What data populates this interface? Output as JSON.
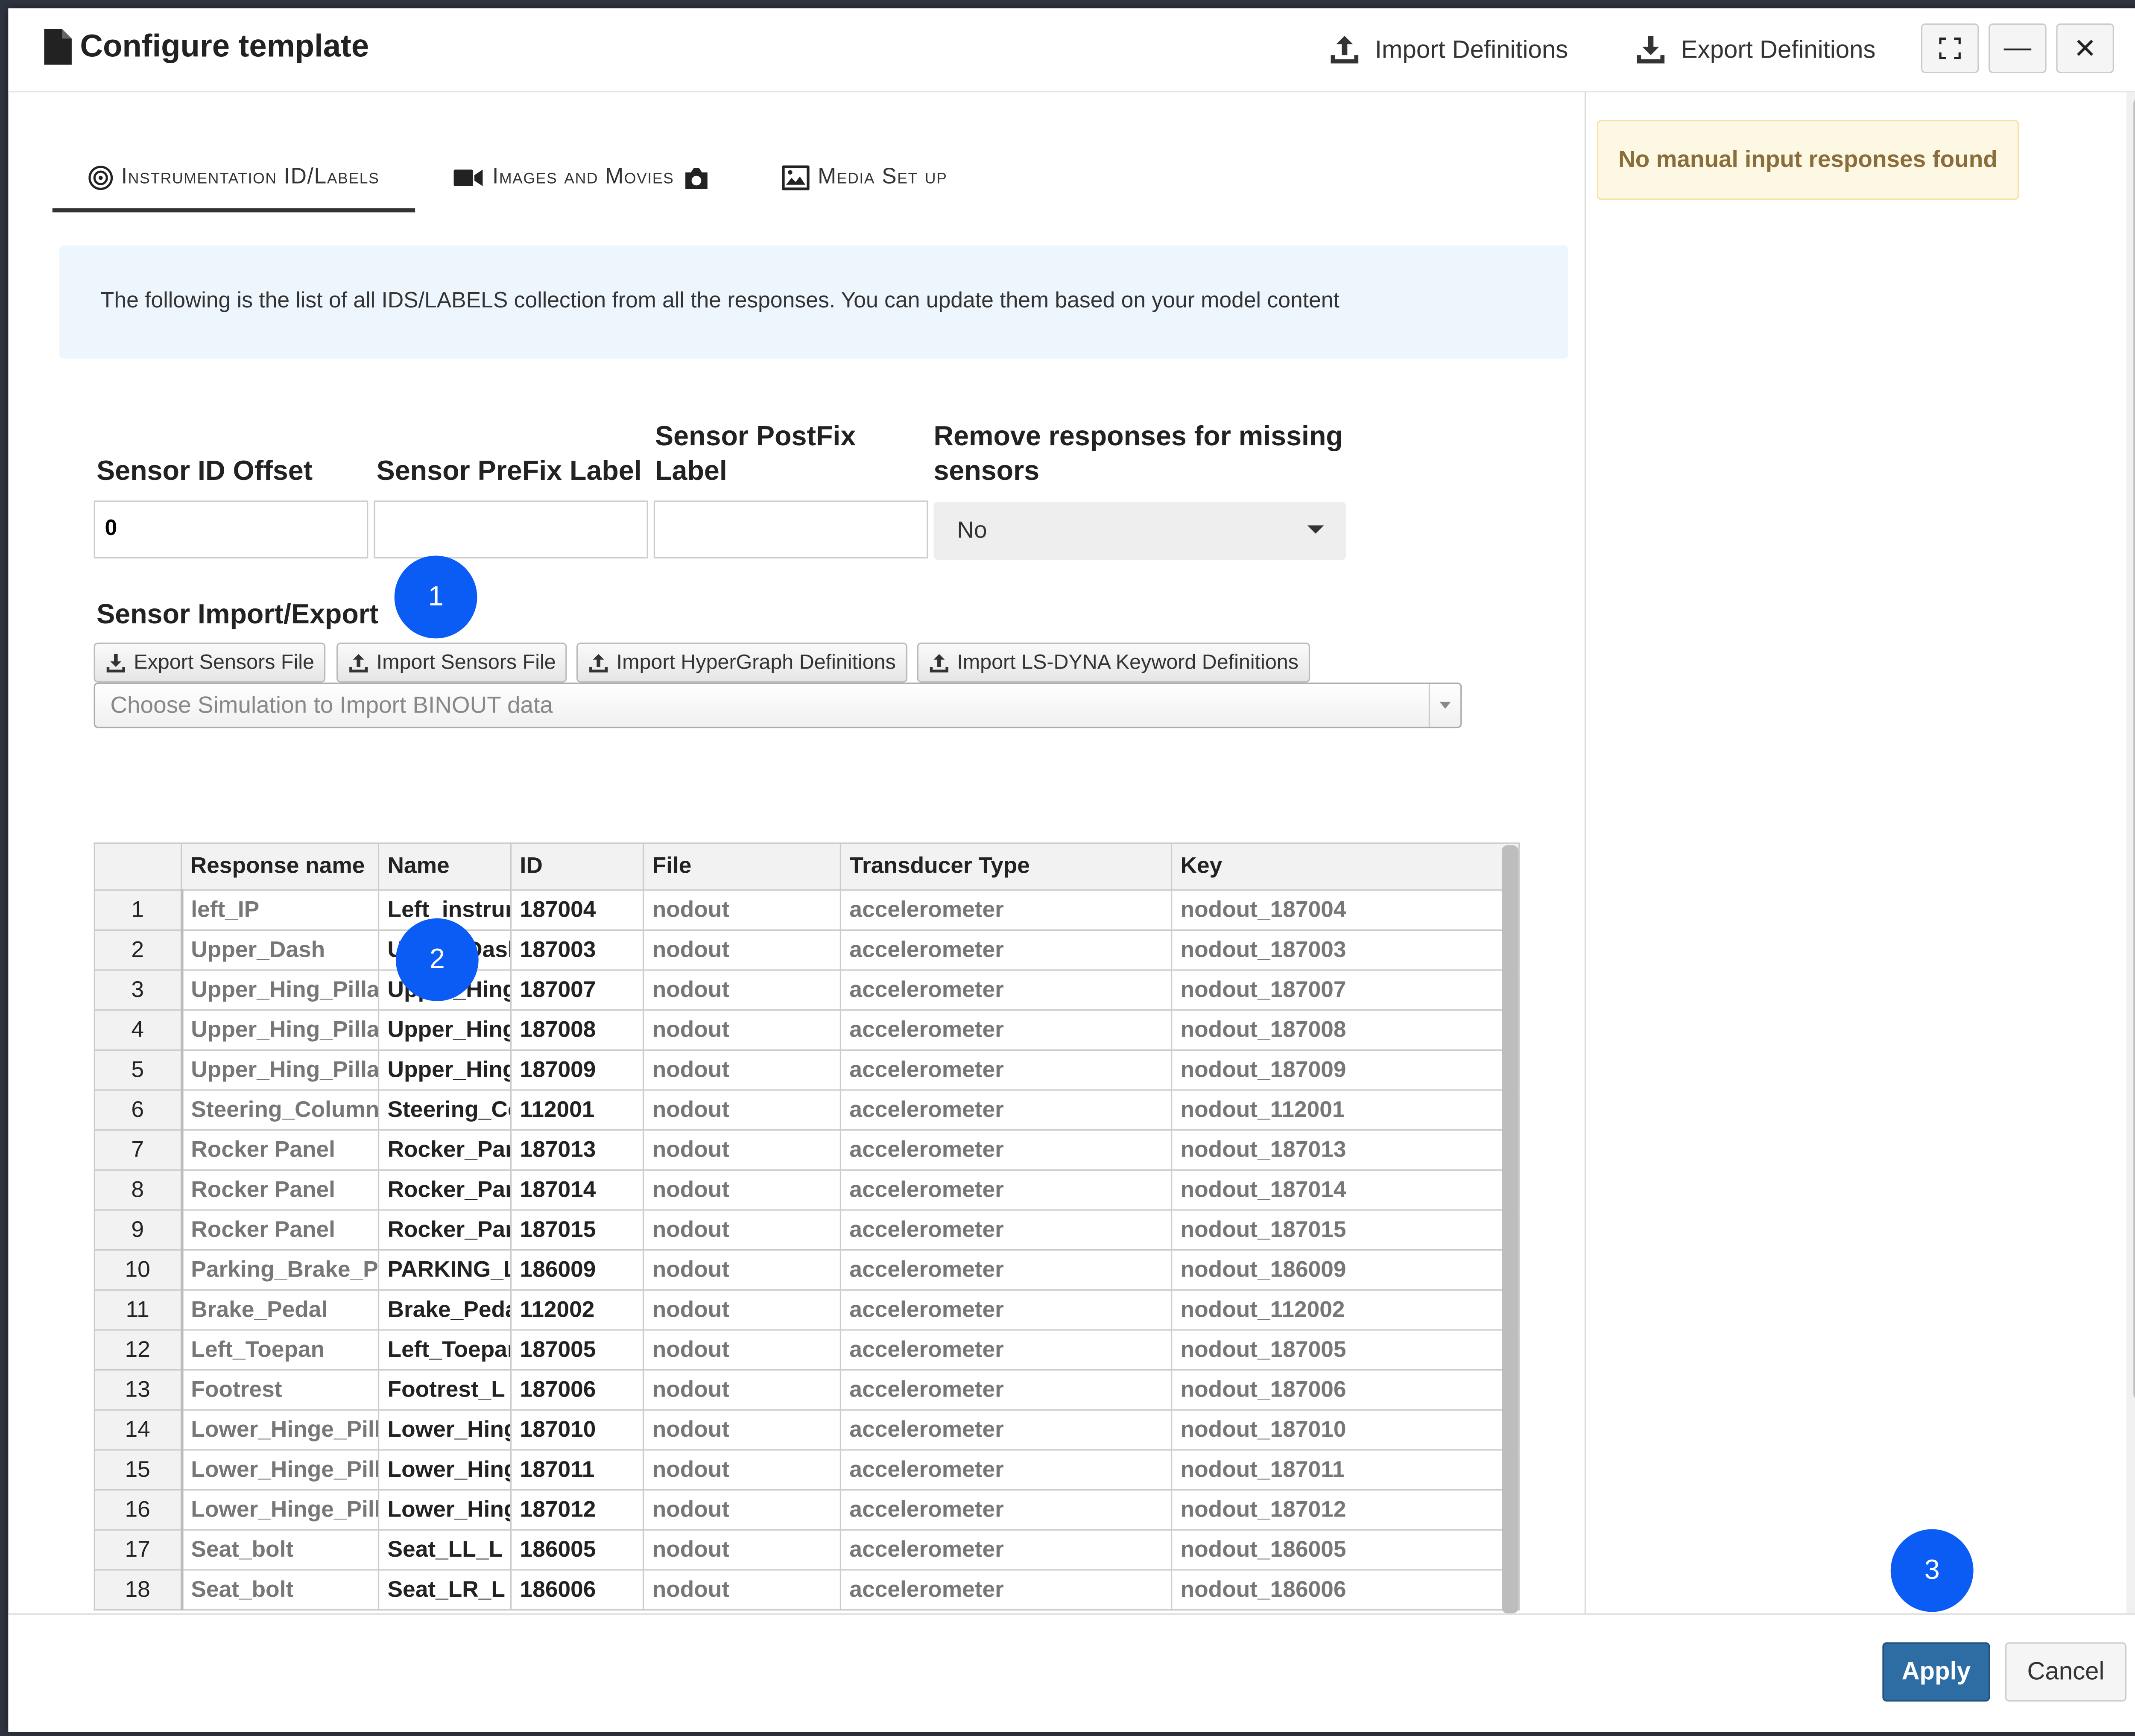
{
  "dialog": {
    "title": "Configure template",
    "import_definitions": "Import Definitions",
    "export_definitions": "Export Definitions"
  },
  "tabs": [
    {
      "label": "Instrumentation ID/Labels",
      "icon": "target-icon",
      "active": true
    },
    {
      "label": "Images and Movies",
      "icon": "video-camera-icon",
      "active": false
    },
    {
      "label": "Media Set up",
      "icon": "image-icon",
      "active": false
    }
  ],
  "info_text": "The following is the list of all IDS/LABELS collection from all the responses. You can update them based on your model content",
  "fields": {
    "sensor_id_offset": {
      "label": "Sensor ID Offset",
      "value": "0"
    },
    "sensor_prefix": {
      "label": "Sensor PreFix Label",
      "value": ""
    },
    "sensor_postfix": {
      "label": "Sensor PostFix Label",
      "value": ""
    },
    "remove_missing": {
      "label": "Remove responses for missing sensors",
      "value": "No"
    }
  },
  "sensor_io": {
    "label": "Sensor Import/Export",
    "buttons": [
      "Export Sensors File",
      "Import Sensors File",
      "Import HyperGraph Definitions",
      "Import LS-DYNA Keyword Definitions"
    ],
    "combo_placeholder": "Choose Simulation to Import BINOUT data"
  },
  "table": {
    "columns": [
      "Response name",
      "Name",
      "ID",
      "File",
      "Transducer Type",
      "Key"
    ],
    "rows": [
      [
        "1",
        "left_IP",
        "Left_instrument",
        "187004",
        "nodout",
        "accelerometer",
        "nodout_187004"
      ],
      [
        "2",
        "Upper_Dash",
        "Upper_Dash",
        "187003",
        "nodout",
        "accelerometer",
        "nodout_187003"
      ],
      [
        "3",
        "Upper_Hing_Pillar",
        "Upper_Hinge",
        "187007",
        "nodout",
        "accelerometer",
        "nodout_187007"
      ],
      [
        "4",
        "Upper_Hing_Pillar",
        "Upper_Hinge",
        "187008",
        "nodout",
        "accelerometer",
        "nodout_187008"
      ],
      [
        "5",
        "Upper_Hing_Pillar",
        "Upper_Hinge",
        "187009",
        "nodout",
        "accelerometer",
        "nodout_187009"
      ],
      [
        "6",
        "Steering_Column",
        "Steering_Col",
        "112001",
        "nodout",
        "accelerometer",
        "nodout_112001"
      ],
      [
        "7",
        "Rocker Panel",
        "Rocker_Panel",
        "187013",
        "nodout",
        "accelerometer",
        "nodout_187013"
      ],
      [
        "8",
        "Rocker Panel",
        "Rocker_Panel",
        "187014",
        "nodout",
        "accelerometer",
        "nodout_187014"
      ],
      [
        "9",
        "Rocker Panel",
        "Rocker_Panel",
        "187015",
        "nodout",
        "accelerometer",
        "nodout_187015"
      ],
      [
        "10",
        "Parking_Brake_Pedal",
        "PARKING_L",
        "186009",
        "nodout",
        "accelerometer",
        "nodout_186009"
      ],
      [
        "11",
        "Brake_Pedal",
        "Brake_Pedal",
        "112002",
        "nodout",
        "accelerometer",
        "nodout_112002"
      ],
      [
        "12",
        "Left_Toepan",
        "Left_Toepan",
        "187005",
        "nodout",
        "accelerometer",
        "nodout_187005"
      ],
      [
        "13",
        "Footrest",
        "Footrest_L",
        "187006",
        "nodout",
        "accelerometer",
        "nodout_187006"
      ],
      [
        "14",
        "Lower_Hinge_Pillar",
        "Lower_Hinge",
        "187010",
        "nodout",
        "accelerometer",
        "nodout_187010"
      ],
      [
        "15",
        "Lower_Hinge_Pillar",
        "Lower_Hinge",
        "187011",
        "nodout",
        "accelerometer",
        "nodout_187011"
      ],
      [
        "16",
        "Lower_Hinge_Pillar",
        "Lower_Hinge",
        "187012",
        "nodout",
        "accelerometer",
        "nodout_187012"
      ],
      [
        "17",
        "Seat_bolt",
        "Seat_LL_L",
        "186005",
        "nodout",
        "accelerometer",
        "nodout_186005"
      ],
      [
        "18",
        "Seat_bolt",
        "Seat_LR_L",
        "186006",
        "nodout",
        "accelerometer",
        "nodout_186006"
      ]
    ]
  },
  "right_panel": {
    "warning": "No manual input responses found"
  },
  "footer": {
    "apply": "Apply",
    "cancel": "Cancel"
  },
  "markers": [
    "1",
    "2",
    "3"
  ],
  "colors": {
    "apply": "#2e6da4",
    "marker": "#0a5cf5",
    "warning_bg": "#fcf8e3",
    "warning_text": "#8a6d3b",
    "info_bg": "#eef6fd"
  }
}
